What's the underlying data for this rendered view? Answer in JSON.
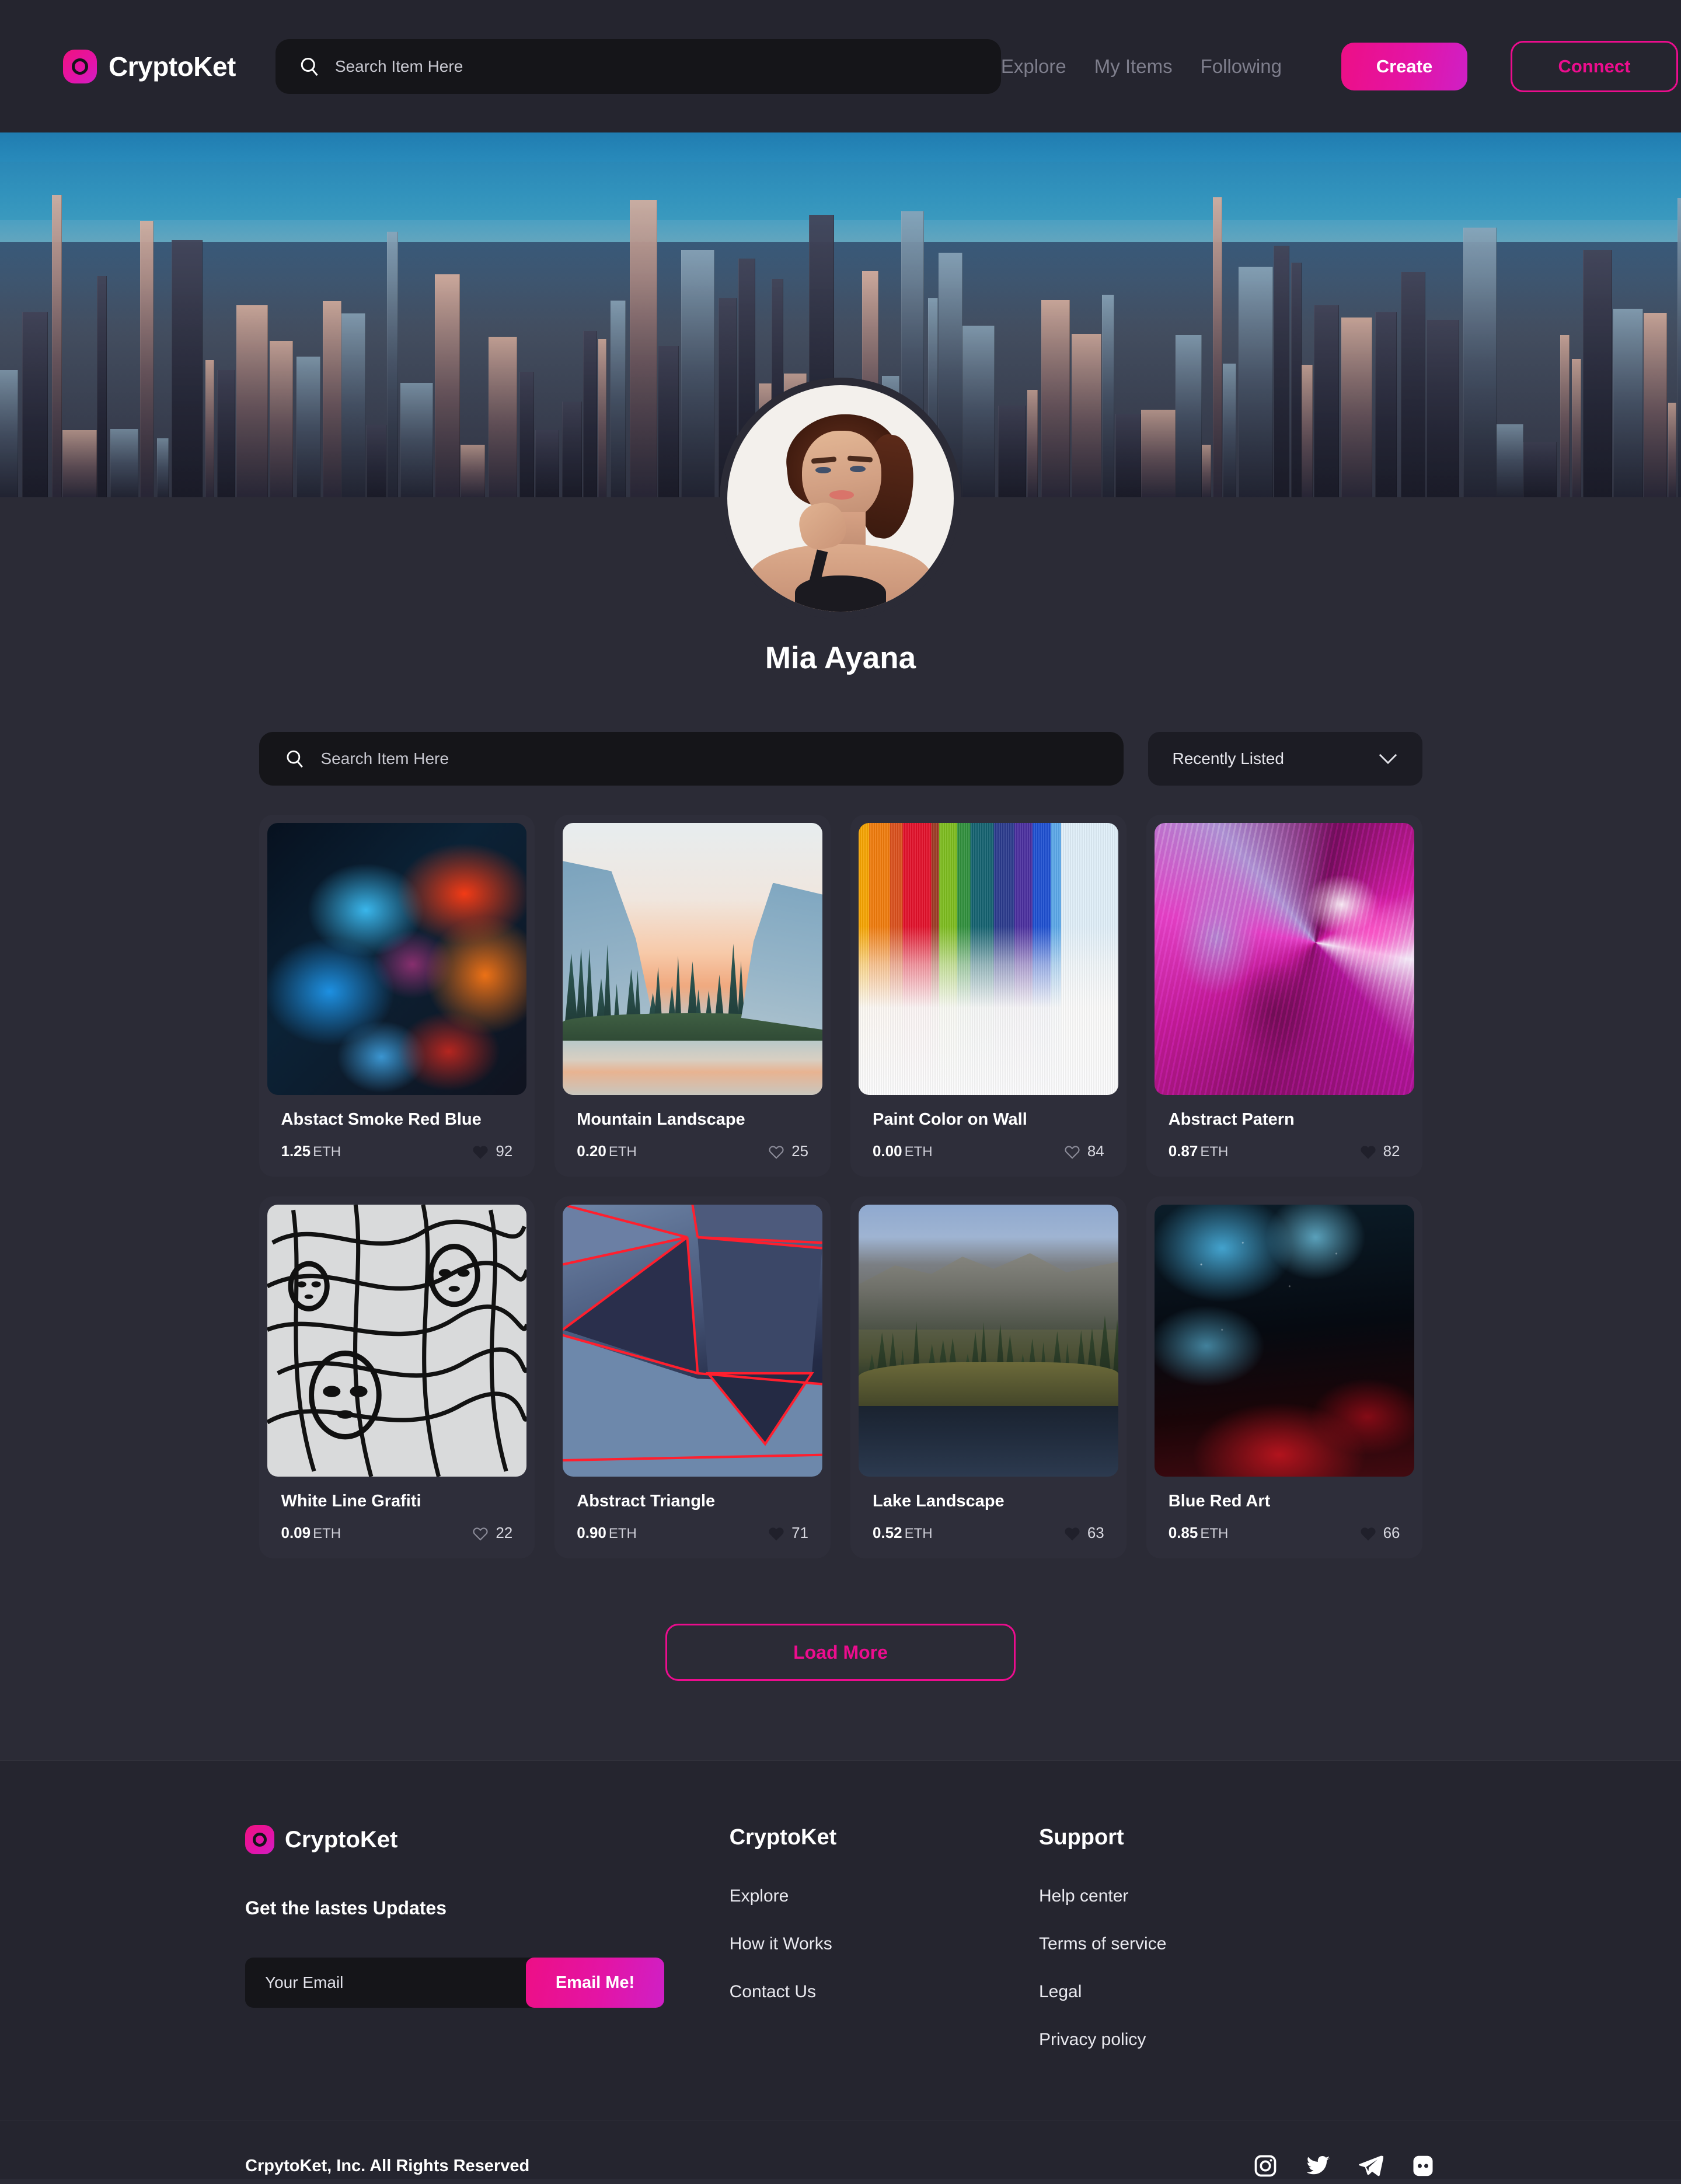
{
  "header": {
    "brand": "CryptoKet",
    "search_placeholder": "Search Item Here",
    "search_value": "",
    "search_icon": "search-icon",
    "nav": [
      {
        "label": "Explore"
      },
      {
        "label": "My Items"
      },
      {
        "label": "Following"
      }
    ],
    "create_label": "Create",
    "connect_label": "Connect",
    "accent": "#ec0d8e",
    "accent_gradient_end": "#cf20c6"
  },
  "profile": {
    "name": "Mia Ayana",
    "banner_alt": "city-skyline-banner",
    "avatar_alt": "user-avatar"
  },
  "filters": {
    "search_placeholder": "Search Item Here",
    "search_value": "",
    "search_icon": "search-icon",
    "sort_value": "Recently Listed",
    "chevron_icon": "chevron-down-icon"
  },
  "nfts": [
    {
      "title": "Abstact Smoke Red Blue",
      "price": "1.25",
      "currency": "ETH",
      "likes": "92",
      "liked": true,
      "art": "art-smoke"
    },
    {
      "title": "Mountain Landscape",
      "price": "0.20",
      "currency": "ETH",
      "likes": "25",
      "liked": false,
      "art": "art-mountain"
    },
    {
      "title": "Paint Color on Wall",
      "price": "0.00",
      "currency": "ETH",
      "likes": "84",
      "liked": false,
      "art": "art-paint"
    },
    {
      "title": "Abstract Patern",
      "price": "0.87",
      "currency": "ETH",
      "likes": "82",
      "liked": true,
      "art": "art-abstract-p"
    },
    {
      "title": "White Line Grafiti",
      "price": "0.09",
      "currency": "ETH",
      "likes": "22",
      "liked": false,
      "art": "art-graffiti"
    },
    {
      "title": "Abstract Triangle",
      "price": "0.90",
      "currency": "ETH",
      "likes": "71",
      "liked": true,
      "art": "art-triangle"
    },
    {
      "title": "Lake Landscape",
      "price": "0.52",
      "currency": "ETH",
      "likes": "63",
      "liked": true,
      "art": "art-lake"
    },
    {
      "title": "Blue Red Art",
      "price": "0.85",
      "currency": "ETH",
      "likes": "66",
      "liked": true,
      "art": "art-bluered"
    }
  ],
  "load_more_label": "Load More",
  "footer": {
    "brand": "CryptoKet",
    "newsletter_title": "Get the lastes Updates",
    "email_placeholder": "Your Email",
    "email_value": "",
    "email_button": "Email Me!",
    "columns": [
      {
        "title": "CryptoKet",
        "links": [
          {
            "label": "Explore"
          },
          {
            "label": "How it Works"
          },
          {
            "label": "Contact Us"
          }
        ]
      },
      {
        "title": "Support",
        "links": [
          {
            "label": "Help center"
          },
          {
            "label": "Terms of service"
          },
          {
            "label": "Legal"
          },
          {
            "label": "Privacy policy"
          }
        ]
      }
    ],
    "copyright": "CrpytoKet, Inc. All Rights Reserved",
    "socials": [
      {
        "name": "instagram-icon"
      },
      {
        "name": "twitter-icon"
      },
      {
        "name": "telegram-icon"
      },
      {
        "name": "discord-icon"
      }
    ]
  }
}
